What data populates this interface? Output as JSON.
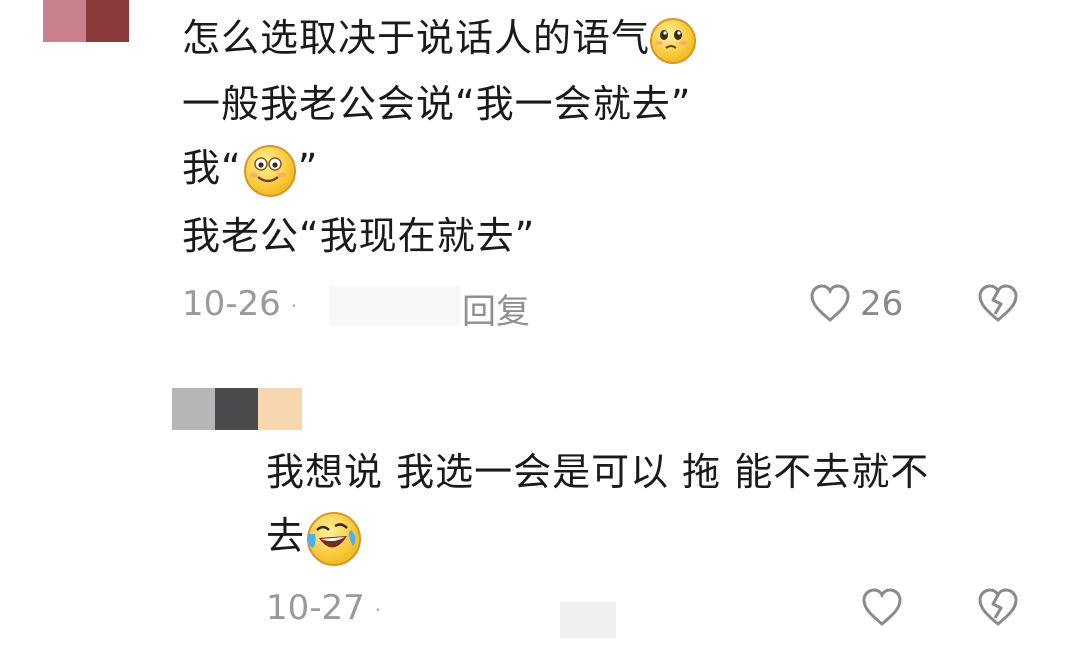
{
  "comment1": {
    "lines": [
      "怎么选取决于说话人的语气",
      "一般我老公会说“我一会就去”",
      "我“",
      "”",
      "我老公“我现在就去”"
    ],
    "date": "10-26",
    "dot": "·",
    "reply_label": "回复",
    "like_count": "26",
    "emoji_1": "pleading-face-emoji",
    "emoji_2": "smiling-face-emoji"
  },
  "comment2": {
    "line1": "我想说 我选一会是可以 拖 能不去就不",
    "line2": "去",
    "emoji": "laughing-tears-emoji",
    "date": "10-27",
    "dot": "·"
  },
  "colors": {
    "text": "#1a1a1a",
    "meta": "#9a9a9a",
    "emoji_yellow": "#f7c531"
  }
}
